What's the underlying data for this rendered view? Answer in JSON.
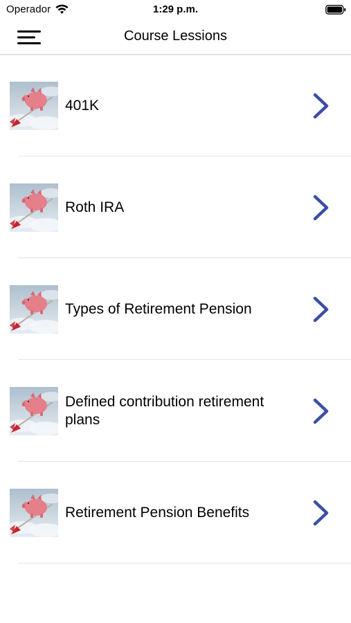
{
  "status_bar": {
    "carrier": "Operador",
    "time": "1:29 p.m."
  },
  "nav": {
    "title": "Course Lessions",
    "menu_icon": "hamburger-menu-icon"
  },
  "lessons": [
    {
      "label": "401K",
      "thumbnail": "piggy-bank-dart-image",
      "chevron": "chevron-right-icon"
    },
    {
      "label": "Roth IRA",
      "thumbnail": "piggy-bank-dart-image",
      "chevron": "chevron-right-icon"
    },
    {
      "label": "Types of Retirement Pension",
      "thumbnail": "piggy-bank-dart-image",
      "chevron": "chevron-right-icon"
    },
    {
      "label": "Defined contribution retirement plans",
      "thumbnail": "piggy-bank-dart-image",
      "chevron": "chevron-right-icon"
    },
    {
      "label": "Retirement Pension Benefits",
      "thumbnail": "piggy-bank-dart-image",
      "chevron": "chevron-right-icon"
    }
  ],
  "colors": {
    "chevron": "#3a4fa6",
    "separator": "#e3e3e3",
    "piggy": "#e57f8a",
    "dart": "#c8232c",
    "sky": "#c9d4df"
  }
}
